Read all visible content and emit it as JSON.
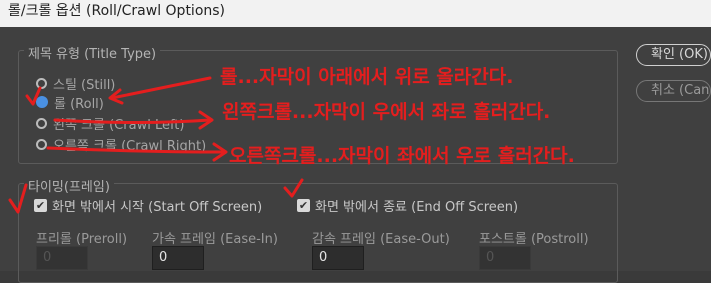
{
  "window": {
    "title": "롤/크롤 옵션 (Roll/Crawl Options)"
  },
  "title_type": {
    "group_label": "제목 유형 (Title Type)",
    "options": [
      {
        "label": "스틸 (Still)",
        "selected": false
      },
      {
        "label": "롤 (Roll)",
        "selected": true
      },
      {
        "label": "왼쪽 크롤 (Crawl Left)",
        "selected": false
      },
      {
        "label": "오른쪽 크롤 (Crawl Right)",
        "selected": false
      }
    ]
  },
  "buttons": {
    "ok": "확인 (OK)",
    "cancel": "취소 (Cancel)"
  },
  "timing": {
    "group_label": "타이밍(프레임)",
    "start_off_screen": {
      "label": "화면 밖에서 시작 (Start Off Screen)",
      "checked": true
    },
    "end_off_screen": {
      "label": "화면 밖에서 종료 (End Off Screen)",
      "checked": true
    },
    "fields": [
      {
        "label": "프리롤 (Preroll)",
        "value": "0",
        "enabled": false
      },
      {
        "label": "가속 프레임 (Ease-In)",
        "value": "0",
        "enabled": true
      },
      {
        "label": "감속 프레임 (Ease-Out)",
        "value": "0",
        "enabled": true
      },
      {
        "label": "포스트롤 (Postroll)",
        "value": "0",
        "enabled": false
      }
    ]
  },
  "annotations": {
    "roll": "롤...자막이 아래에서 위로 올라간다.",
    "crawl_left": "왼쪽크롤...자막이 우에서 좌로 흘러간다.",
    "crawl_right": "오른쪽크롤...자막이 좌에서 우로 흘러간다.",
    "color": "#e41e1e"
  },
  "colors": {
    "accent": "#4a90e2",
    "panel": "#404040",
    "titlebar": "#f2f2f2"
  }
}
